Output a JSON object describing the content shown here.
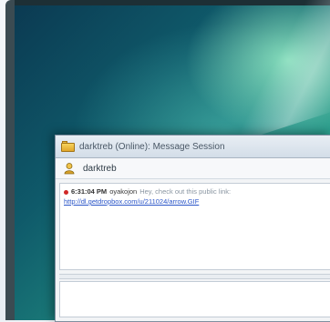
{
  "window": {
    "title": "darktreb (Online): Message Session"
  },
  "contact": {
    "name": "darktreb"
  },
  "messages": [
    {
      "time": "6:31:04 PM",
      "sender": "oyakojon",
      "text": "Hey, check out this public link:",
      "link": "http://dl.getdropbox.com/u/211024/arrow.GIF"
    }
  ],
  "input": {
    "value": ""
  },
  "colors": {
    "link": "#2a55c8",
    "status_dot": "#d02828",
    "wallpaper_accent": "#2aa48a"
  }
}
